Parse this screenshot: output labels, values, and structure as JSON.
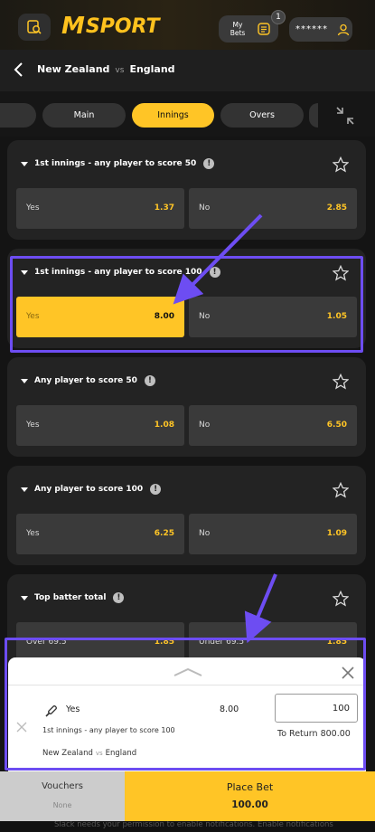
{
  "header": {
    "brand_m": "M",
    "brand_name": "SPORT",
    "my_bets_label": "My Bets",
    "my_bets_count": "1",
    "balance_masked": "******"
  },
  "match": {
    "home": "New Zealand",
    "vs": "vs",
    "away": "England"
  },
  "tabs": [
    {
      "label": "Main",
      "active": false
    },
    {
      "label": "Innings",
      "active": true
    },
    {
      "label": "Overs",
      "active": false
    }
  ],
  "markets": [
    {
      "title": "1st innings - any player to score 50",
      "yes": "Yes",
      "yes_odds": "1.37",
      "no": "No",
      "no_odds": "2.85"
    },
    {
      "title": "1st innings - any player to score 100",
      "yes": "Yes",
      "yes_odds": "8.00",
      "no": "No",
      "no_odds": "1.05"
    },
    {
      "title": "Any player to score 50",
      "yes": "Yes",
      "yes_odds": "1.08",
      "no": "No",
      "no_odds": "6.50"
    },
    {
      "title": "Any player to score 100",
      "yes": "Yes",
      "yes_odds": "6.25",
      "no": "No",
      "no_odds": "1.09"
    },
    {
      "title": "Top batter total",
      "yes": "Over 69.5",
      "yes_odds": "1.85",
      "no": "Under 69.5",
      "no_odds": "1.85"
    }
  ],
  "betslip": {
    "outcome": "Yes",
    "market": "1st innings - any player to score 100",
    "home": "New Zealand",
    "vs": "vs",
    "away": "England",
    "odds": "8.00",
    "stake": "100",
    "to_return": "To Return 800.00"
  },
  "bottom": {
    "vouchers_label": "Vouchers",
    "vouchers_value": "None",
    "place_bet_label": "Place Bet",
    "place_bet_amount": "100.00"
  },
  "notification": "Slack needs your permission to enable notifications. Enable notifications",
  "colors": {
    "accent": "#ffc526",
    "annotation": "#6d4df2"
  }
}
